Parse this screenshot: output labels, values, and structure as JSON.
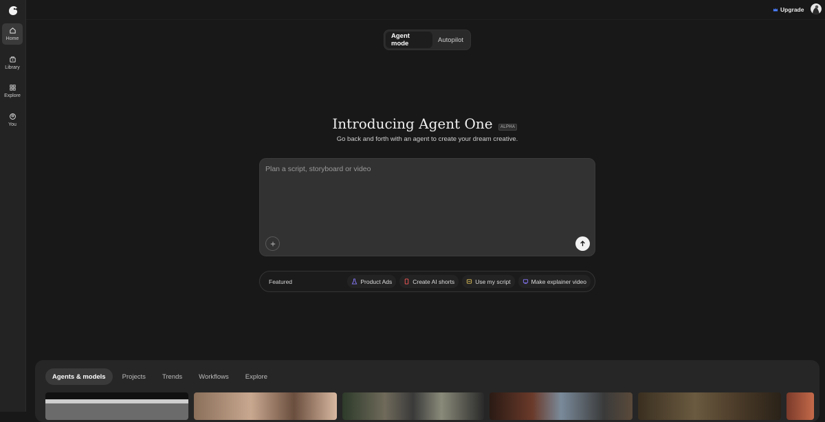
{
  "sidebar": {
    "items": [
      {
        "label": "Home",
        "icon": "home-icon",
        "active": true
      },
      {
        "label": "Library",
        "icon": "library-icon",
        "active": false
      },
      {
        "label": "Explore",
        "icon": "explore-icon",
        "active": false
      },
      {
        "label": "You",
        "icon": "user-icon",
        "active": false
      }
    ]
  },
  "header": {
    "upgrade_label": "Upgrade"
  },
  "mode": {
    "tabs": [
      "Agent mode",
      "Autopilot"
    ],
    "active": "Agent mode"
  },
  "hero": {
    "title": "Introducing Agent One",
    "badge": "ALPHA",
    "subtitle": "Go back and forth with an agent to create your dream creative."
  },
  "composer": {
    "placeholder": "Plan a script, storyboard or video"
  },
  "featured": {
    "label": "Featured",
    "chips": [
      {
        "label": "Product Ads",
        "icon": "flask-icon",
        "color": "#8a7bff"
      },
      {
        "label": "Create AI shorts",
        "icon": "phone-icon",
        "color": "#ff5a5a"
      },
      {
        "label": "Use my script",
        "icon": "script-icon",
        "color": "#e0c25a"
      },
      {
        "label": "Make explainer video",
        "icon": "presentation-icon",
        "color": "#8a7bff"
      }
    ]
  },
  "bottom_tabs": {
    "items": [
      "Agents & models",
      "Projects",
      "Trends",
      "Workflows",
      "Explore"
    ],
    "active": "Agents & models"
  },
  "colors": {
    "background": "#181818",
    "sidebar": "#232323",
    "composer": "#323232",
    "upgrade_icon": "#4a7dff"
  }
}
